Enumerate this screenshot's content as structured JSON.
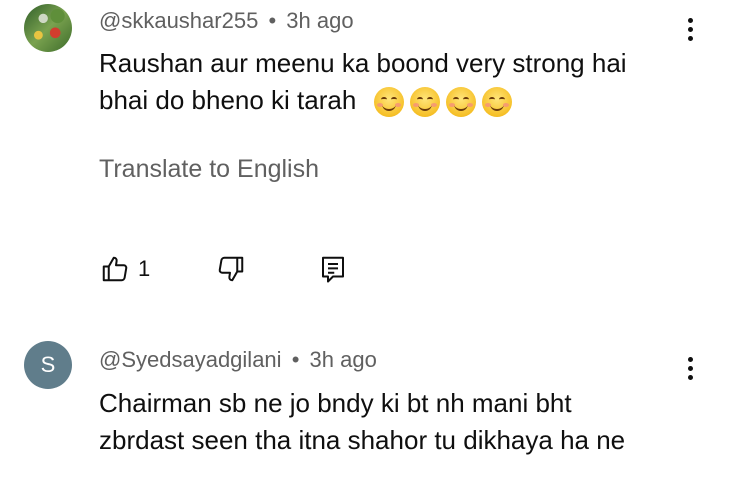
{
  "comments": [
    {
      "author": "@skkaushar255",
      "separator": "•",
      "time": "3h ago",
      "text_line1": "Raushan aur meenu ka boond very strong hai",
      "text_line2": "bhai do bheno ki tarah",
      "emojis": [
        "smiling-face-with-smiling-eyes",
        "smiling-face-with-smiling-eyes",
        "smiling-face-with-smiling-eyes",
        "smiling-face-with-smiling-eyes"
      ],
      "translate_label": "Translate to English",
      "like_count": "1",
      "icons": {
        "like": "thumbs-up-icon",
        "dislike": "thumbs-down-icon",
        "reply": "reply-comment-icon",
        "menu": "more-vert-icon"
      }
    },
    {
      "author": "@Syedsayadgilani",
      "separator": "•",
      "time": "3h ago",
      "avatar_letter": "S",
      "avatar_color": "#607d8b",
      "text_line1": "Chairman sb ne jo bndy ki bt nh mani bht",
      "text_line2": "zbrdast seen tha itna shahor tu dikhaya ha ne"
    }
  ]
}
